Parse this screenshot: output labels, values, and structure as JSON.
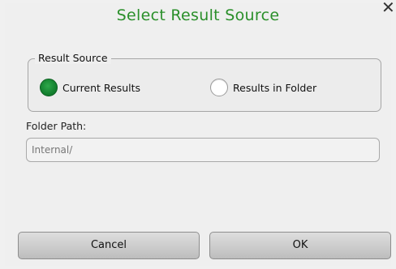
{
  "dialog": {
    "title": "Select Result Source",
    "close_icon": "close-icon"
  },
  "result_source": {
    "legend": "Result Source",
    "options": [
      {
        "label": "Current Results",
        "selected": true
      },
      {
        "label": "Results in Folder",
        "selected": false
      }
    ]
  },
  "folder_path": {
    "label": "Folder Path:",
    "value": "Internal/"
  },
  "buttons": {
    "cancel_label": "Cancel",
    "ok_label": "OK"
  },
  "colors": {
    "title": "#2a8f2a",
    "radio_selected": "#14812f",
    "background": "#efefef"
  }
}
